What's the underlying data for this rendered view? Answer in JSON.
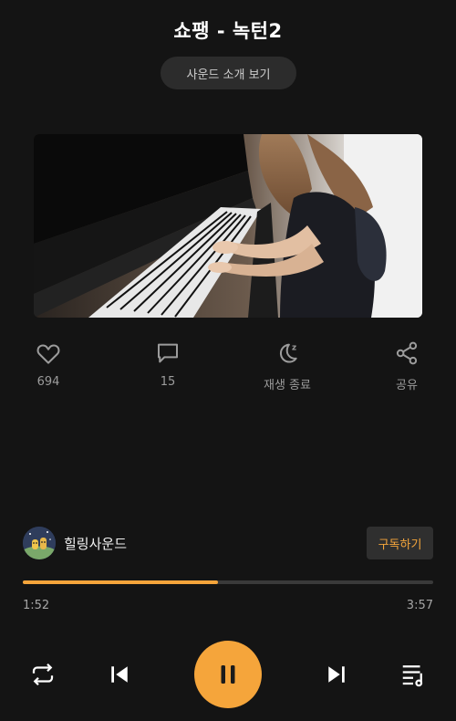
{
  "header": {
    "title": "쇼팽 - 녹턴2",
    "intro_button": "사운드 소개 보기"
  },
  "video": {
    "thumbnail": "piano-player-image"
  },
  "actions": [
    {
      "icon": "heart-icon",
      "label": "694"
    },
    {
      "icon": "comment-icon",
      "label": "15"
    },
    {
      "icon": "moon-sleep-icon",
      "label": "재생 종료"
    },
    {
      "icon": "share-icon",
      "label": "공유"
    }
  ],
  "channel": {
    "name": "힐링사운드",
    "subscribe_label": "구독하기"
  },
  "player": {
    "elapsed": "1:52",
    "duration": "3:57",
    "progress": 0.475,
    "accent": "#f5a53b"
  },
  "controls": {
    "repeat": "repeat-icon",
    "previous": "skip-previous-icon",
    "play_pause": "pause-icon",
    "next": "skip-next-icon",
    "playlist": "playlist-icon"
  }
}
